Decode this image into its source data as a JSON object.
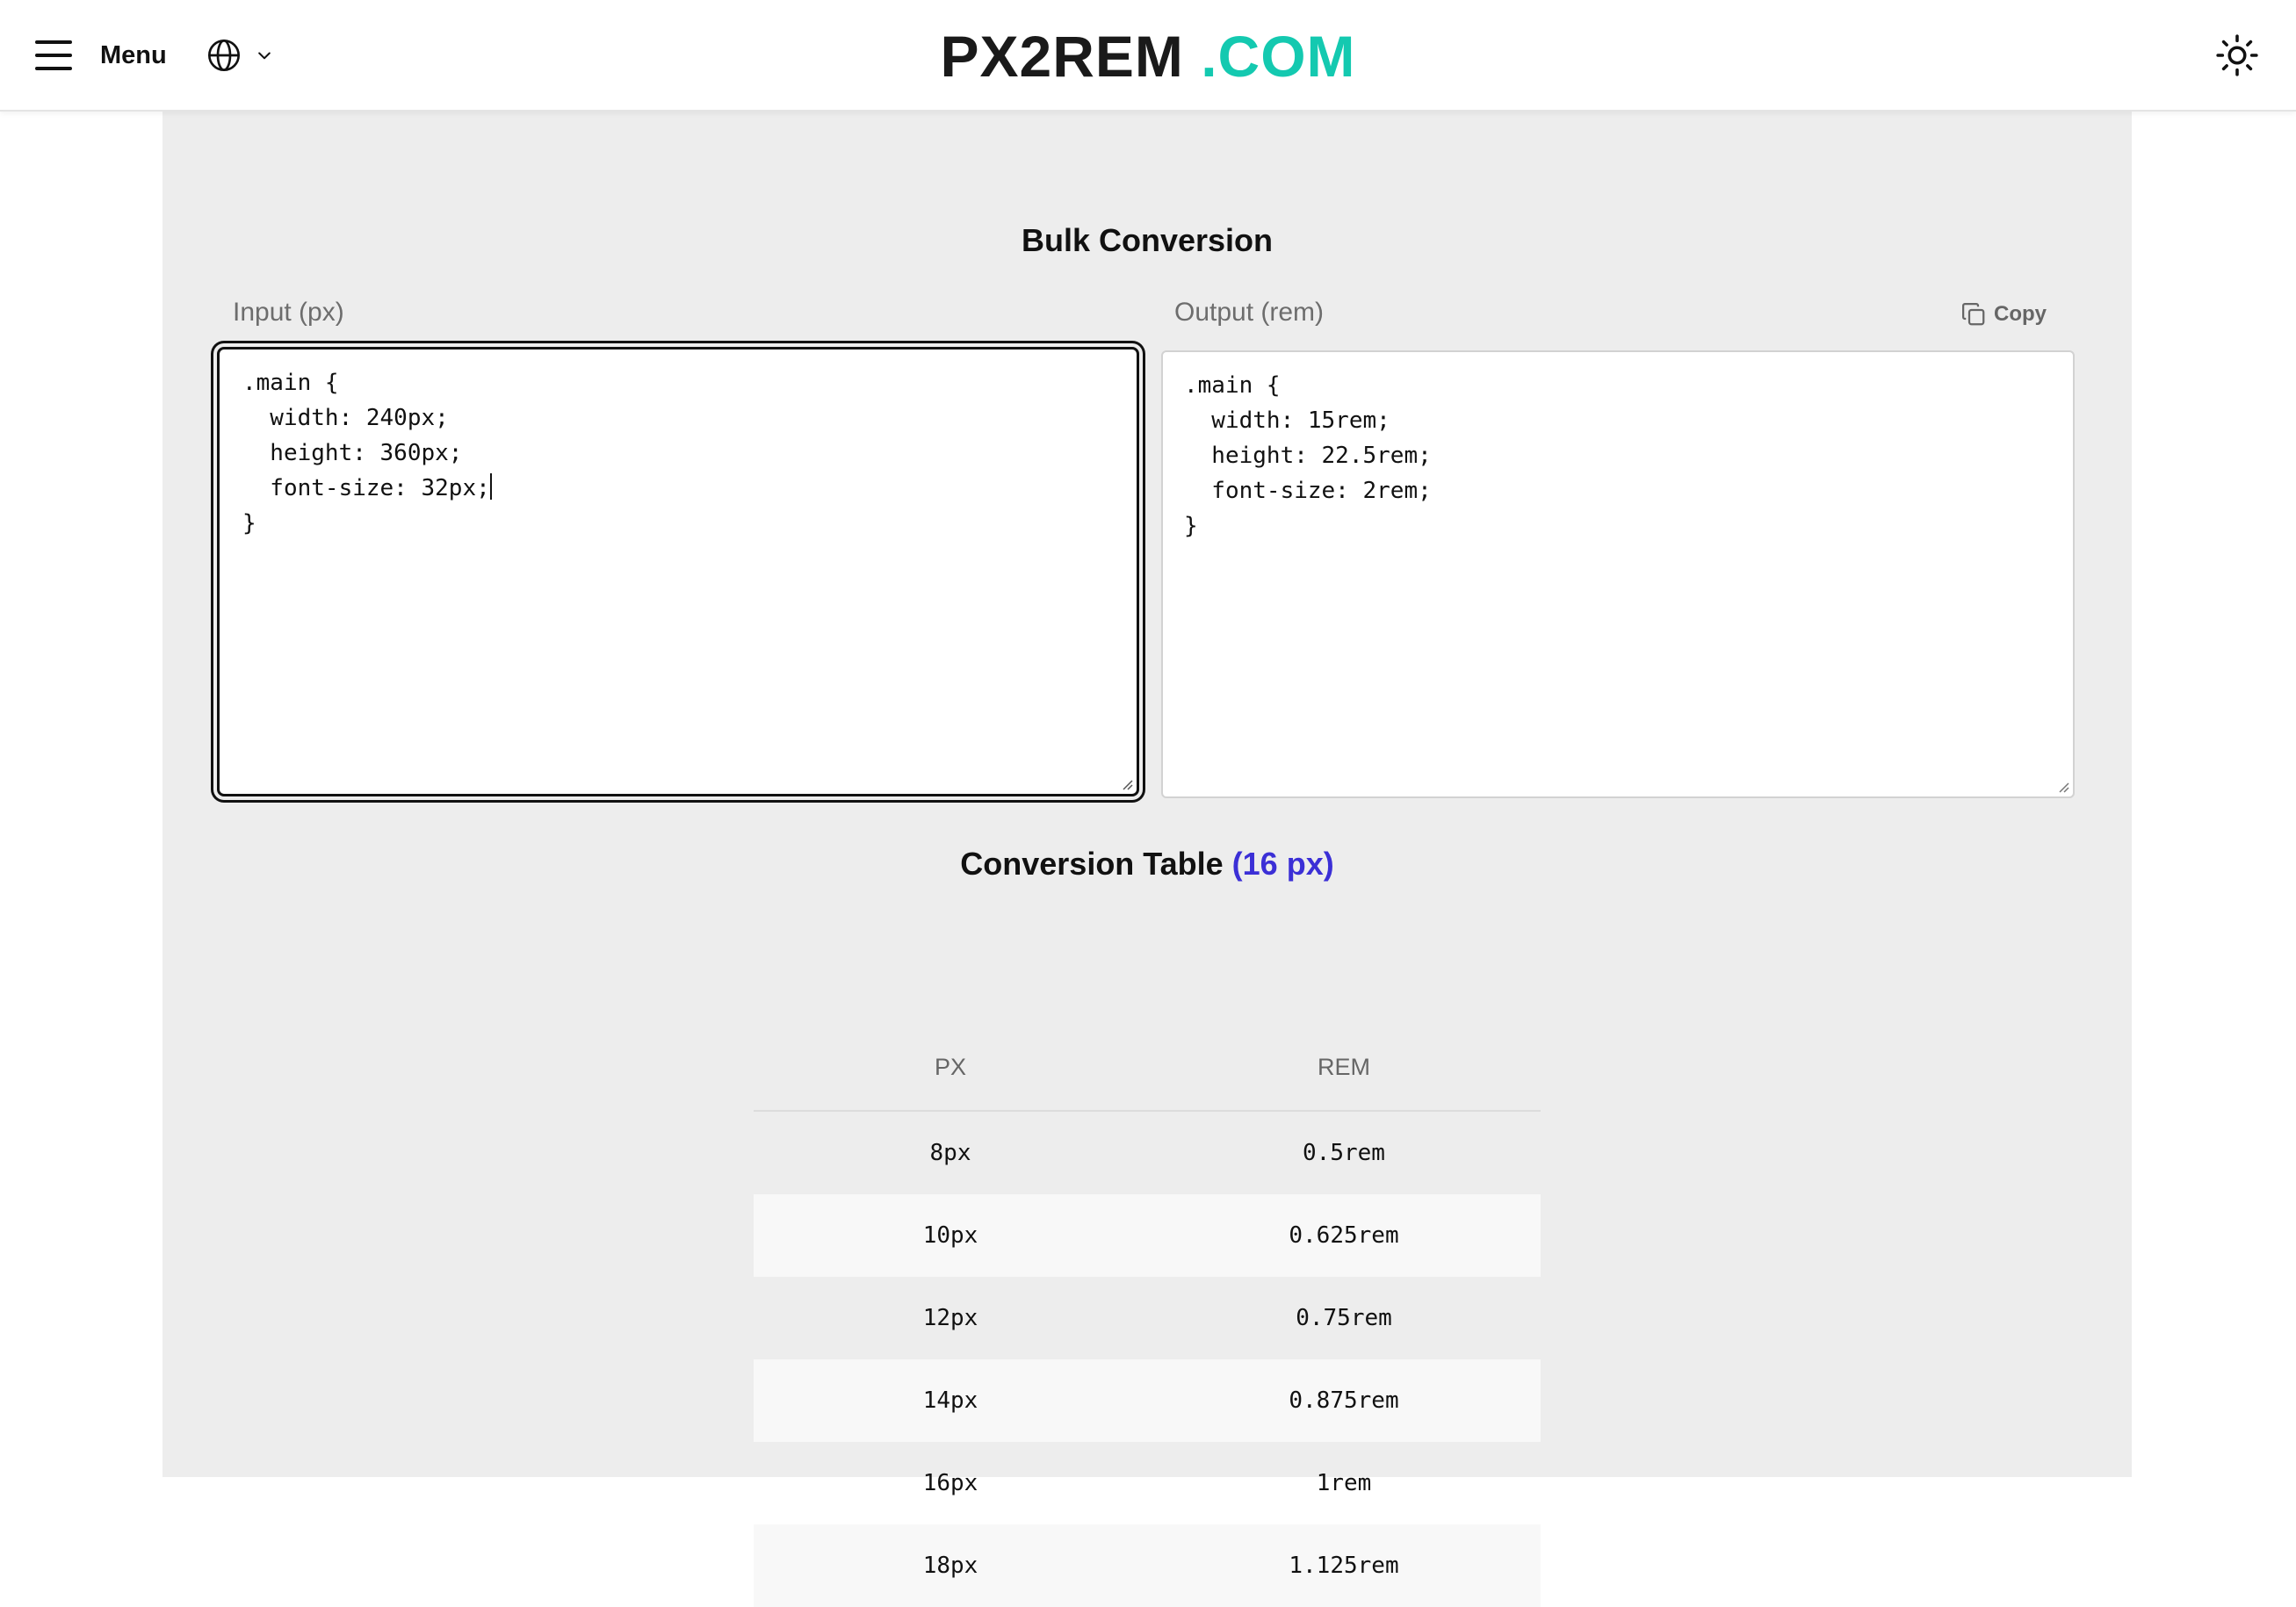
{
  "header": {
    "menu_label": "Menu",
    "logo_main": "PX2REM",
    "logo_tld": ".COM",
    "icons": {
      "menu": "hamburger-icon",
      "language": "globe-icon",
      "language_dropdown": "chevron-down-icon",
      "theme": "sun-icon"
    }
  },
  "bulk": {
    "title": "Bulk Conversion",
    "input_label": "Input (px)",
    "output_label": "Output (rem)",
    "copy_label": "Copy",
    "copy_icon": "copy-icon",
    "input_text": ".main {\n  width: 240px;\n  height: 360px;\n  font-size: 32px;",
    "input_text_end": "\n}",
    "output_text": ".main {\n  width: 15rem;\n  height: 22.5rem;\n  font-size: 2rem;\n}"
  },
  "table": {
    "title": "Conversion Table",
    "base_label": "(16 px)",
    "headers": [
      "PX",
      "REM"
    ],
    "rows": [
      {
        "px": "8px",
        "rem": "0.5rem"
      },
      {
        "px": "10px",
        "rem": "0.625rem"
      },
      {
        "px": "12px",
        "rem": "0.75rem"
      },
      {
        "px": "14px",
        "rem": "0.875rem"
      },
      {
        "px": "16px",
        "rem": "1rem"
      },
      {
        "px": "18px",
        "rem": "1.125rem"
      }
    ]
  },
  "colors": {
    "accent_teal": "#14c9b0",
    "accent_purple": "#3b2fd6",
    "panel_bg": "#ededed"
  }
}
